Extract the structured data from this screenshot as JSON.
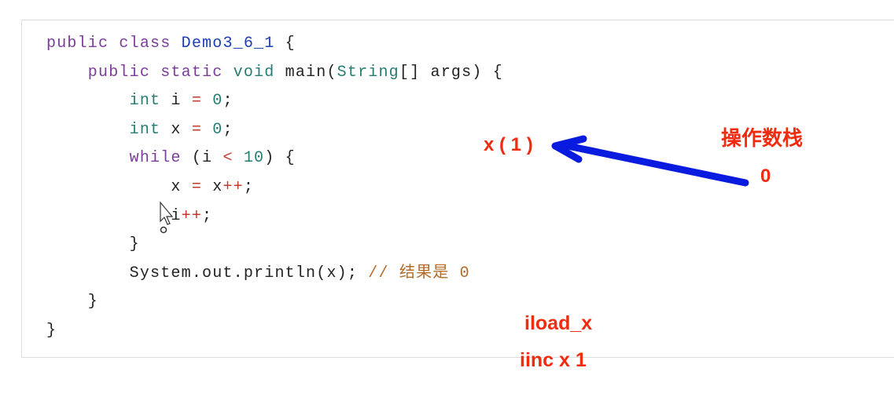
{
  "colors": {
    "keyword": "#7b3d99",
    "class_name": "#1e3fb2",
    "type": "#257d74",
    "number": "#257d74",
    "operator": "#c0392b",
    "comment": "#b36b2a",
    "plain": "#222222",
    "annotation": "#f02c10",
    "arrow": "#0a1be0"
  },
  "code_lines": [
    [
      [
        "public class ",
        "keyword"
      ],
      [
        "Demo3_6_1",
        "class_name"
      ],
      [
        " {",
        "plain"
      ]
    ],
    [
      [
        "    public static ",
        "keyword"
      ],
      [
        "void",
        "type"
      ],
      [
        " main(",
        "plain"
      ],
      [
        "String",
        "type"
      ],
      [
        "[] args) {",
        "plain"
      ]
    ],
    [
      [
        "        ",
        "plain"
      ],
      [
        "int",
        "type"
      ],
      [
        " i ",
        "plain"
      ],
      [
        "=",
        "operator"
      ],
      [
        " ",
        "plain"
      ],
      [
        "0",
        "number"
      ],
      [
        ";",
        "plain"
      ]
    ],
    [
      [
        "        ",
        "plain"
      ],
      [
        "int",
        "type"
      ],
      [
        " x ",
        "plain"
      ],
      [
        "=",
        "operator"
      ],
      [
        " ",
        "plain"
      ],
      [
        "0",
        "number"
      ],
      [
        ";",
        "plain"
      ]
    ],
    [
      [
        "        ",
        "plain"
      ],
      [
        "while",
        "keyword"
      ],
      [
        " (i ",
        "plain"
      ],
      [
        "<",
        "operator"
      ],
      [
        " ",
        "plain"
      ],
      [
        "10",
        "number"
      ],
      [
        ") {",
        "plain"
      ]
    ],
    [
      [
        "            x ",
        "plain"
      ],
      [
        "=",
        "operator"
      ],
      [
        " x",
        "plain"
      ],
      [
        "++",
        "operator"
      ],
      [
        ";",
        "plain"
      ]
    ],
    [
      [
        "            i",
        "plain"
      ],
      [
        "++",
        "operator"
      ],
      [
        ";",
        "plain"
      ]
    ],
    [
      [
        "        }",
        "plain"
      ]
    ],
    [
      [
        "        System.out.println(x); ",
        "plain"
      ],
      [
        "// 结果是 0",
        "comment"
      ]
    ],
    [
      [
        "    }",
        "plain"
      ]
    ],
    [
      [
        "}",
        "plain"
      ]
    ]
  ],
  "annotations": {
    "variable_label": "x ( 1 )",
    "stack_title": "操作数栈",
    "stack_value": "0",
    "instruction_1": "iload_x",
    "instruction_2": "iinc x 1"
  }
}
